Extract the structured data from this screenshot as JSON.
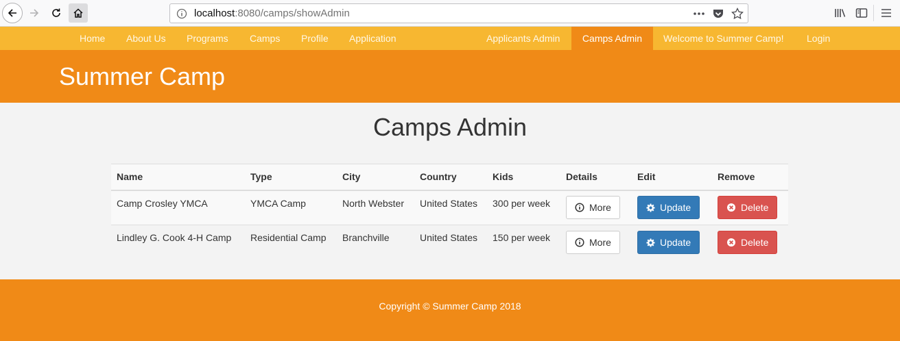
{
  "browser": {
    "url_host": "localhost",
    "url_rest": ":8080/camps/showAdmin"
  },
  "nav": {
    "left": [
      "Home",
      "About Us",
      "Programs",
      "Camps",
      "Profile",
      "Application"
    ],
    "right": [
      "Applicants Admin",
      "Camps Admin",
      "Welcome to Summer Camp!",
      "Login"
    ],
    "active": "Camps Admin"
  },
  "site_title": "Summer Camp",
  "page_heading": "Camps Admin",
  "table": {
    "headers": [
      "Name",
      "Type",
      "City",
      "Country",
      "Kids",
      "Details",
      "Edit",
      "Remove"
    ],
    "rows": [
      {
        "name": "Camp Crosley YMCA",
        "type": "YMCA Camp",
        "city": "North Webster",
        "country": "United States",
        "kids": "300 per week"
      },
      {
        "name": "Lindley G. Cook 4-H Camp",
        "type": "Residential Camp",
        "city": "Branchville",
        "country": "United States",
        "kids": "150 per week"
      }
    ],
    "more_label": "More",
    "update_label": "Update",
    "delete_label": "Delete"
  },
  "footer": "Copyright © Summer Camp 2018",
  "colors": {
    "navbar": "#f7b731",
    "accent": "#f08a17",
    "primary": "#337ab7",
    "danger": "#d9534f"
  }
}
